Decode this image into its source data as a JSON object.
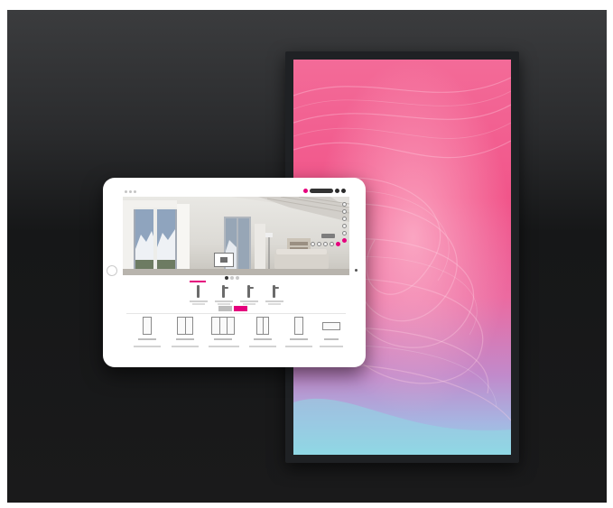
{
  "scene": {
    "background_color": "#1b1c1d",
    "display_bezel_color": "#1f2124",
    "accent_color": "#e5007d"
  },
  "display": {
    "wallpaper": "abstract-pink-swirl",
    "colors": [
      "#f25a8f",
      "#f47aa6",
      "#e26faa",
      "#c890c9",
      "#9fd2e3"
    ]
  },
  "tablet": {
    "status_bar_icon": "dots-icon",
    "toolbar_icons": [
      "pink-dot-icon",
      "toolbar-pill",
      "round-button-icon",
      "round-button-icon"
    ],
    "room_view": {
      "scene": "living-room-with-mountain-windows",
      "side_icons": [
        "circle-icon",
        "circle-icon",
        "circle-icon",
        "circle-icon",
        "circle-icon",
        "circle-icon"
      ],
      "control_icons": [
        "circle-icon",
        "circle-icon",
        "circle-icon",
        "circle-icon",
        "pink-circle-icon"
      ]
    },
    "carousel_dots": 3,
    "handles": [
      {
        "name": "handle-1",
        "selected": true
      },
      {
        "name": "handle-2",
        "selected": false
      },
      {
        "name": "handle-3",
        "selected": false
      },
      {
        "name": "handle-4",
        "selected": false
      }
    ],
    "toggle": [
      "option-a",
      "option-b"
    ],
    "windows": [
      {
        "type": "single-window"
      },
      {
        "type": "double-window"
      },
      {
        "type": "triple-window"
      },
      {
        "type": "double-door"
      },
      {
        "type": "single-door"
      },
      {
        "type": "horizontal-window"
      }
    ]
  }
}
